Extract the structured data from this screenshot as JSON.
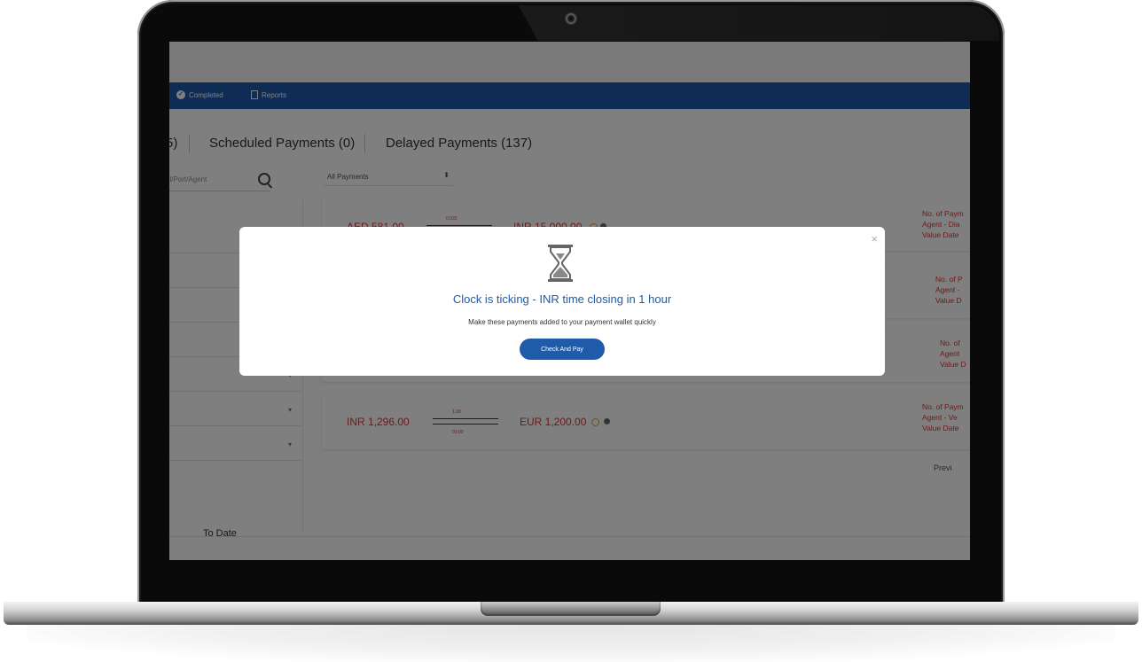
{
  "nav": {
    "items": [
      {
        "label": "Completed",
        "icon": "check-circle-icon"
      },
      {
        "label": "Reports",
        "icon": "document-icon"
      }
    ]
  },
  "tabs": [
    {
      "label": "5)"
    },
    {
      "label": "Scheduled Payments (0)"
    },
    {
      "label": "Delayed Payments (137)"
    }
  ],
  "search": {
    "placeholder": "el/Port/Agent"
  },
  "filter": {
    "selected": "All Payments"
  },
  "sidebar": {
    "to_date_label": "To Date"
  },
  "payments": [
    {
      "from_amount": "AED 581.00",
      "rate": "0.033",
      "to_amount": "INR 15,000.00",
      "meta": [
        "No. of Paym",
        "Agent - Dia",
        "Value Date"
      ]
    },
    {
      "meta": [
        "No. of P",
        "Agent -",
        "Value D"
      ]
    },
    {
      "meta": [
        "No. of",
        "Agent",
        "Value D"
      ]
    },
    {
      "from_amount": "INR 1,296.00",
      "rate": "1.08",
      "rate_time": "03:00",
      "to_amount": "EUR 1,200.00",
      "meta": [
        "No. of Paym",
        "Agent - Ve",
        "Value Date"
      ]
    }
  ],
  "pagination": {
    "prev": "Previ"
  },
  "modal": {
    "title": "Clock is ticking - INR time closing in 1 hour",
    "message": "Make these payments added to your payment wallet quickly",
    "button": "Check And Pay",
    "close": "×"
  },
  "colors": {
    "brand": "#1f5ba8",
    "amount": "#dd3333"
  }
}
